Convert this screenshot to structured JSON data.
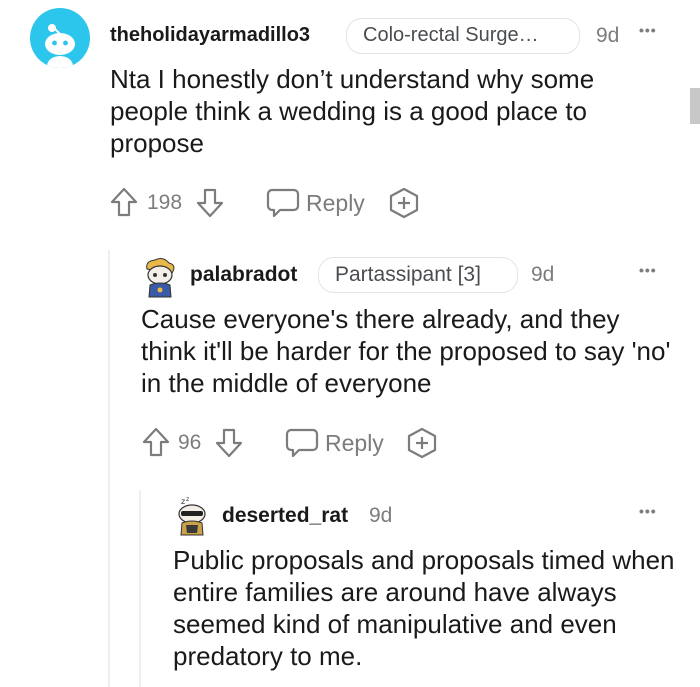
{
  "comments": [
    {
      "username": "theholidayarmadillo3",
      "flair": "Colo-rectal Surge…",
      "age": "9d",
      "more": "•••",
      "body": "Nta I honestly don’t understand why some people think a wedding is a good place to propose",
      "votes": "198",
      "reply_label": "Reply"
    },
    {
      "username": "palabradot",
      "flair": "Partassipant [3]",
      "age": "9d",
      "more": "•••",
      "body": "Cause everyone's there already, and they think it'll be harder for the proposed to say 'no' in the middle of everyone",
      "votes": "96",
      "reply_label": "Reply"
    },
    {
      "username": "deserted_rat",
      "age": "9d",
      "more": "•••",
      "body": "Public proposals and proposals timed when entire families are around have always seemed kind of manipulative and even predatory to me."
    }
  ],
  "icons": {
    "avatar_1": "snoo-avatar-icon",
    "avatar_2": "snoo-avatar-icon",
    "avatar_3": "snoo-avatar-icon",
    "upvote": "arrow-up-icon",
    "downvote": "arrow-down-icon",
    "reply": "speech-bubble-icon",
    "award": "plus-award-icon"
  },
  "colors": {
    "avatar_1_bg": "#2cc5eb",
    "text_muted": "#7c7c7c",
    "thread_line": "#edeff1"
  }
}
